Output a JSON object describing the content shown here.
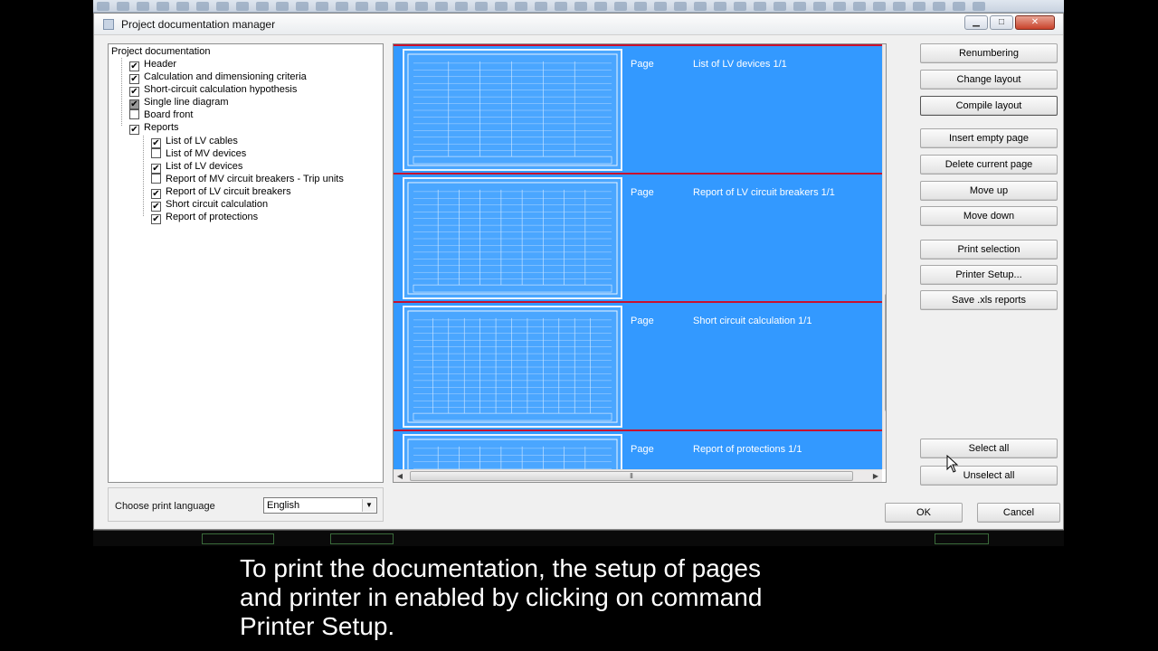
{
  "dialog": {
    "title": "Project documentation manager"
  },
  "tree": {
    "root": "Project documentation",
    "items": [
      {
        "label": "Header",
        "state": "checked"
      },
      {
        "label": "Calculation and dimensioning criteria",
        "state": "checked"
      },
      {
        "label": "Short-circuit calculation hypothesis",
        "state": "checked"
      },
      {
        "label": "Single line diagram",
        "state": "partial"
      },
      {
        "label": "Board front",
        "state": "unchecked"
      },
      {
        "label": "Reports",
        "state": "checked"
      }
    ],
    "reports": [
      {
        "label": "List of LV cables",
        "state": "checked"
      },
      {
        "label": "List of MV devices",
        "state": "unchecked"
      },
      {
        "label": "List of LV devices",
        "state": "checked"
      },
      {
        "label": "Report of MV circuit breakers - Trip units",
        "state": "unchecked"
      },
      {
        "label": "Report of LV circuit breakers",
        "state": "checked"
      },
      {
        "label": "Short circuit calculation",
        "state": "checked"
      },
      {
        "label": "Report of protections",
        "state": "checked"
      }
    ]
  },
  "language": {
    "label": "Choose print language",
    "selected": "English"
  },
  "pages": [
    {
      "type": "Page",
      "name": "List of LV devices 1/1"
    },
    {
      "type": "Page",
      "name": "Report of LV circuit breakers 1/1"
    },
    {
      "type": "Page",
      "name": "Short circuit calculation 1/1"
    },
    {
      "type": "Page",
      "name": "Report of protections 1/1"
    }
  ],
  "buttons": {
    "renumbering": "Renumbering",
    "change_layout": "Change layout",
    "compile_layout": "Compile layout",
    "insert_empty_page": "Insert empty page",
    "delete_current_page": "Delete current page",
    "move_up": "Move up",
    "move_down": "Move down",
    "print_selection": "Print selection",
    "printer_setup": "Printer Setup...",
    "save_xls": "Save .xls reports",
    "select_all": "Select all",
    "unselect_all": "Unselect all",
    "ok": "OK",
    "cancel": "Cancel"
  },
  "caption": {
    "line1": "To print the documentation, the setup of pages",
    "line2": "and printer in enabled by clicking on command",
    "line3": "Printer Setup."
  },
  "colors": {
    "selection": "#3399ff",
    "separator": "#c8102e"
  }
}
